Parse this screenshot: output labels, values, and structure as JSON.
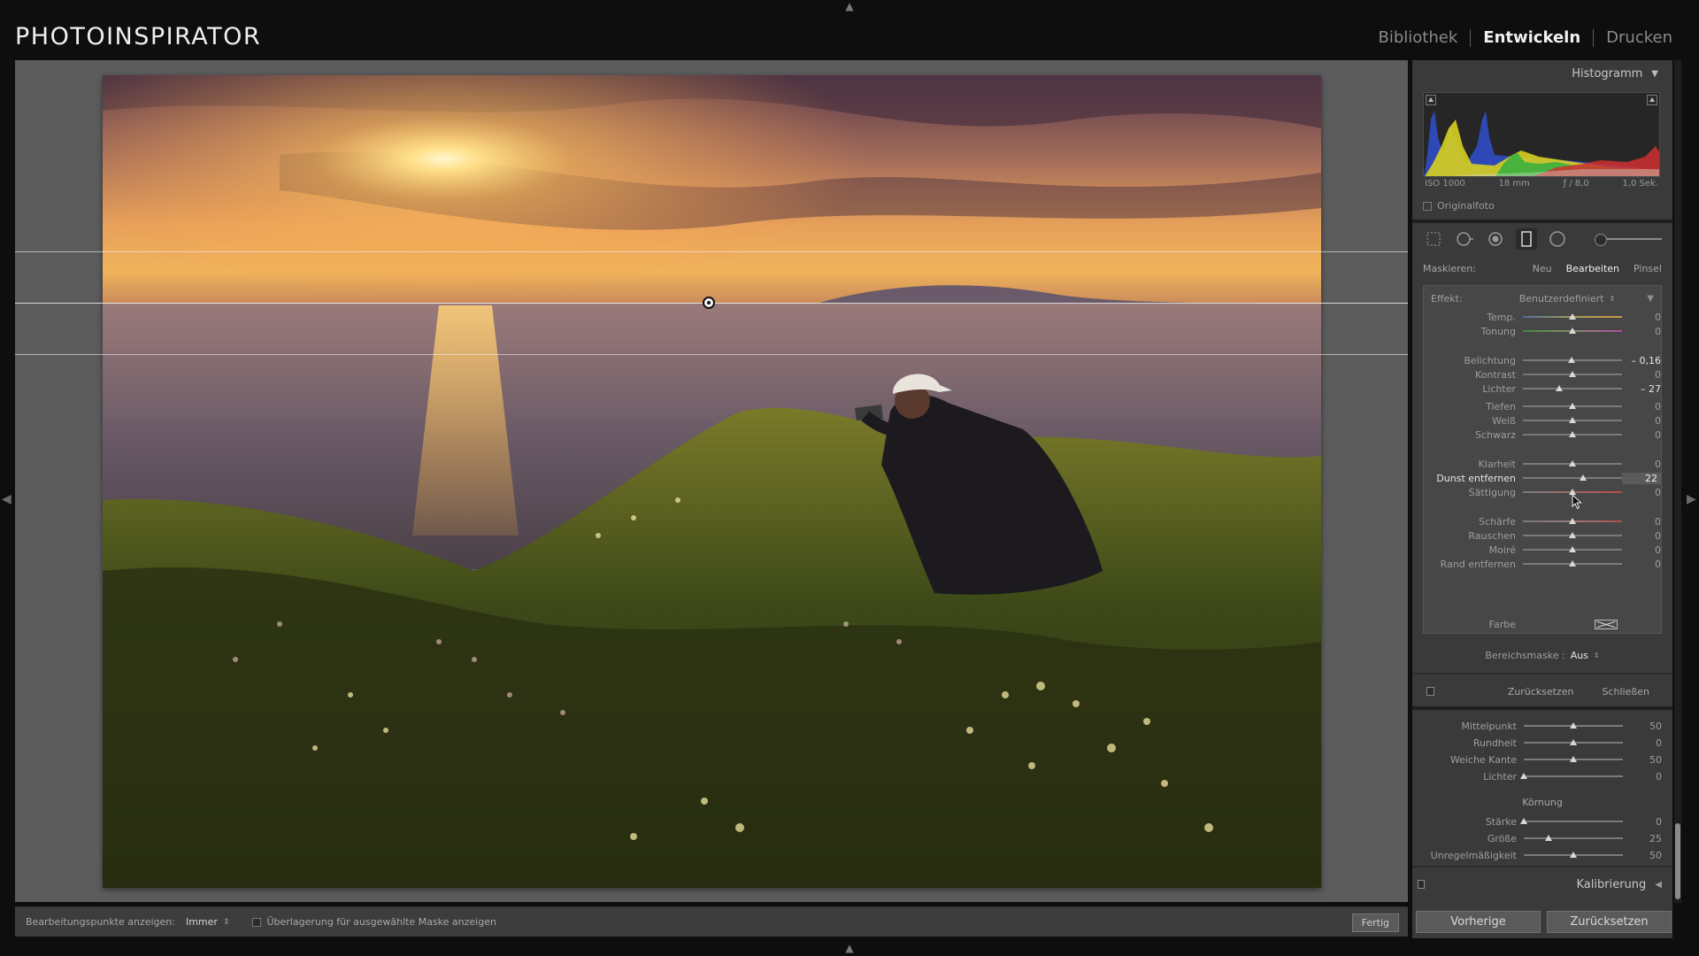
{
  "app": {
    "brand": "PHOTOINSPIRATOR"
  },
  "modules": [
    {
      "label": "Bibliothek",
      "active": false
    },
    {
      "label": "Entwickeln",
      "active": true
    },
    {
      "label": "Drucken",
      "active": false
    }
  ],
  "histogram": {
    "title": "Histogramm",
    "iso": "ISO 1000",
    "focal": "18 mm",
    "aperture": "ƒ / 8,0",
    "shutter": "1,0 Sek.",
    "original_label": "Originalfoto"
  },
  "mask": {
    "label": "Maskieren:",
    "options": [
      "Neu",
      "Bearbeiten",
      "Pinsel"
    ],
    "active": "Bearbeiten"
  },
  "effect": {
    "label": "Effekt:",
    "preset": "Benutzerdefiniert",
    "sliders": [
      {
        "label": "Temp.",
        "value": "0",
        "level": 0.5
      },
      {
        "label": "Tonung",
        "value": "0",
        "level": 0.5
      },
      {
        "label": "Belichtung",
        "value": "– 0,16",
        "level": 0.49
      },
      {
        "label": "Kontrast",
        "value": "0",
        "level": 0.5
      },
      {
        "label": "Lichter",
        "value": "– 27",
        "level": 0.37
      },
      {
        "label": "Tiefen",
        "value": "0",
        "level": 0.5
      },
      {
        "label": "Weiß",
        "value": "0",
        "level": 0.5
      },
      {
        "label": "Schwarz",
        "value": "0",
        "level": 0.5
      },
      {
        "label": "Klarheit",
        "value": "0",
        "level": 0.5
      },
      {
        "label": "Dunst entfernen",
        "value": "22",
        "level": 0.61
      },
      {
        "label": "Sättigung",
        "value": "0",
        "level": 0.5
      },
      {
        "label": "Schärfe",
        "value": "0",
        "level": 0.5
      },
      {
        "label": "Rauschen",
        "value": "0",
        "level": 0.5
      },
      {
        "label": "Moiré",
        "value": "0",
        "level": 0.5
      },
      {
        "label": "Rand entfernen",
        "value": "0",
        "level": 0.5
      }
    ],
    "farbe_label": "Farbe"
  },
  "range_mask": {
    "label": "Bereichsmaske :",
    "value": "Aus"
  },
  "mask_footer": {
    "reset": "Zurücksetzen",
    "close": "Schließen"
  },
  "lower_sliders": [
    {
      "label": "Mittelpunkt",
      "value": "50",
      "level": 0.5
    },
    {
      "label": "Rundheit",
      "value": "0",
      "level": 0.5
    },
    {
      "label": "Weiche Kante",
      "value": "50",
      "level": 0.5
    },
    {
      "label": "Lichter",
      "value": "0",
      "level": 0.0
    }
  ],
  "grain": {
    "title": "Körnung",
    "sliders": [
      {
        "label": "Stärke",
        "value": "0",
        "level": 0.0
      },
      {
        "label": "Größe",
        "value": "25",
        "level": 0.25
      },
      {
        "label": "Unregelmäßigkeit",
        "value": "50",
        "level": 0.5
      }
    ]
  },
  "calibration": {
    "label": "Kalibrierung"
  },
  "toolbar": {
    "points_label": "Bearbeitungspunkte anzeigen:",
    "points_value": "Immer",
    "overlay_label": "Überlagerung für ausgewählte Maske anzeigen",
    "done": "Fertig"
  },
  "bottom": {
    "previous": "Vorherige",
    "reset": "Zurücksetzen"
  }
}
